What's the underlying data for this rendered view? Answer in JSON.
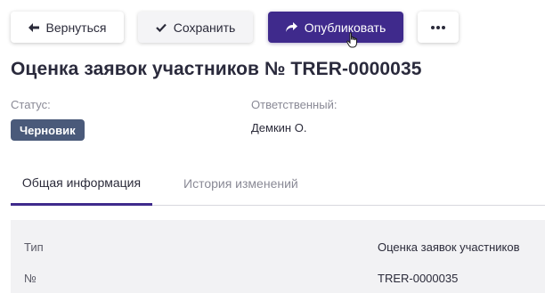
{
  "toolbar": {
    "back_label": "Вернуться",
    "save_label": "Сохранить",
    "publish_label": "Опубликовать",
    "more_icon": "more-horizontal-icon"
  },
  "document": {
    "title": "Оценка заявок участников № TRER-0000035"
  },
  "fields": {
    "status_label": "Статус:",
    "status_value": "Черновик",
    "owner_label": "Ответственный:",
    "owner_value": "Демкин О."
  },
  "tabs": [
    {
      "label": "Общая информация",
      "active": true
    },
    {
      "label": "История изменений",
      "active": false
    }
  ],
  "details": {
    "rows": [
      {
        "label": "Тип",
        "value": "Оценка заявок участников"
      },
      {
        "label": "№",
        "value": "TRER-0000035"
      }
    ]
  },
  "colors": {
    "primary": "#3f2a8c",
    "status_badge": "#4a5a7a",
    "panel_bg": "#f2f2f4"
  }
}
